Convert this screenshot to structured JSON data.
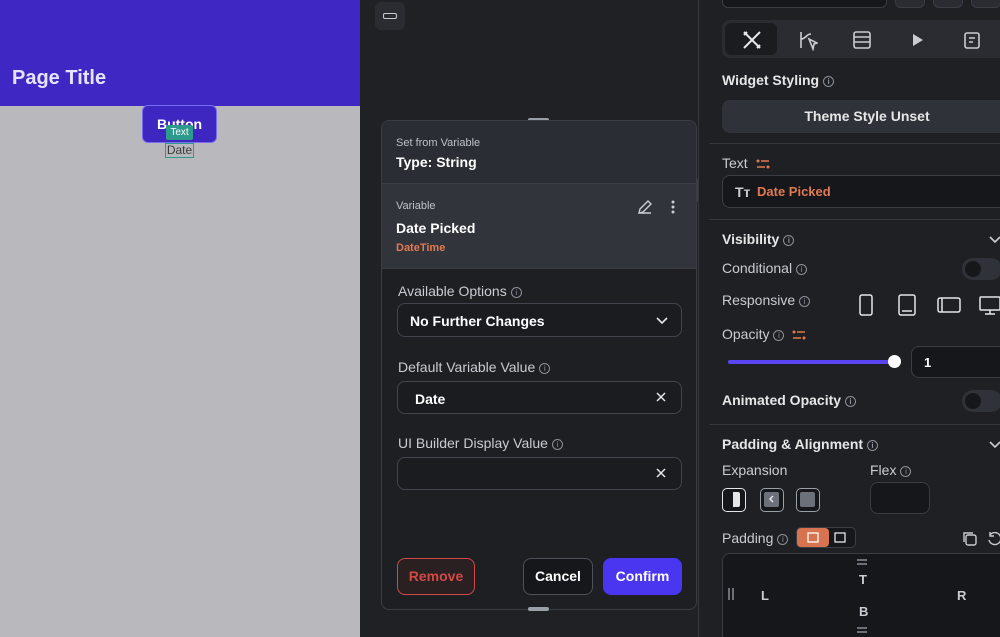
{
  "canvas": {
    "page_title": "Page Title",
    "button_label": "Button",
    "text_tag": "Text",
    "text_value": "Date"
  },
  "popup": {
    "header_sub": "Set from Variable",
    "header_type": "Type: String",
    "variable_label": "Variable",
    "variable_name": "Date Picked",
    "variable_type": "DateTime",
    "available_options_label": "Available Options",
    "available_options_value": "No Further Changes",
    "default_value_label": "Default Variable Value",
    "default_value": "Date",
    "ui_builder_label": "UI Builder Display Value",
    "ui_builder_value": "",
    "remove_label": "Remove",
    "cancel_label": "Cancel",
    "confirm_label": "Confirm"
  },
  "right_panel": {
    "widget_styling_label": "Widget Styling",
    "theme_style_label": "Theme Style Unset",
    "text_label": "Text",
    "text_value": "Date Picked",
    "visibility_label": "Visibility",
    "conditional_label": "Conditional",
    "responsive_label": "Responsive",
    "opacity_label": "Opacity",
    "opacity_value": "1",
    "opacity_level": 1.0,
    "animated_opacity_label": "Animated Opacity",
    "padding_alignment_label": "Padding & Alignment",
    "expansion_label": "Expansion",
    "flex_label": "Flex",
    "padding_label": "Padding",
    "pad_top": "T",
    "pad_bottom": "B",
    "pad_left": "L",
    "pad_right": "R"
  },
  "colors": {
    "accent": "#4a36f0",
    "appbar": "#3f27c4",
    "variable_orange": "#e07a53",
    "remove_red": "#d24a45"
  }
}
